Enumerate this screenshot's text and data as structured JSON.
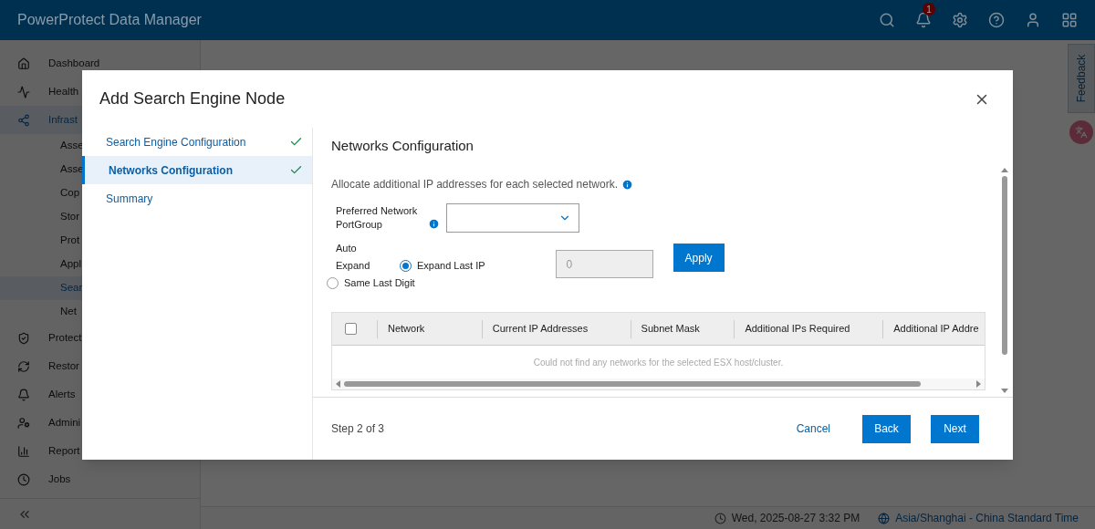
{
  "app": {
    "title": "PowerProtect Data Manager",
    "notification_count": "1"
  },
  "sidebar": {
    "items": [
      {
        "label": "Dashboard",
        "selected": false
      },
      {
        "label": "Health",
        "selected": false
      },
      {
        "label": "Infrast",
        "selected": true,
        "children": [
          {
            "label": "Asse",
            "selected": false
          },
          {
            "label": "Asse",
            "selected": false
          },
          {
            "label": "Cop",
            "selected": false
          },
          {
            "label": "Stor",
            "selected": false
          },
          {
            "label": "Prot",
            "selected": false
          },
          {
            "label": "Appl",
            "selected": false
          },
          {
            "label": "Sear",
            "selected": true
          },
          {
            "label": "Net",
            "selected": false
          }
        ]
      },
      {
        "label": "Protect",
        "selected": false
      },
      {
        "label": "Restor",
        "selected": false
      },
      {
        "label": "Alerts",
        "selected": false
      },
      {
        "label": "Admini",
        "selected": false
      },
      {
        "label": "Report",
        "selected": false
      },
      {
        "label": "Jobs",
        "selected": false
      }
    ]
  },
  "feedback_tab": {
    "label": "Feedback"
  },
  "status_bar": {
    "datetime": "Wed, 2025-08-27 3:32 PM",
    "timezone": "Asia/Shanghai - China Standard Time"
  },
  "dialog": {
    "title": "Add Search Engine Node",
    "steps": [
      {
        "label": "Search Engine Configuration",
        "done": true,
        "selected": false
      },
      {
        "label": "Networks Configuration",
        "done": true,
        "selected": true
      },
      {
        "label": "Summary",
        "done": false,
        "selected": false
      }
    ],
    "heading": "Networks Configuration",
    "description": "Allocate additional IP addresses for each selected network.",
    "portgroup": {
      "label": "Preferred Network PortGroup"
    },
    "auto_expand": {
      "label_1": "Auto",
      "label_2": "Expand",
      "options": [
        {
          "label": "Expand Last IP",
          "selected": true
        },
        {
          "label": "Same Last Digit",
          "selected": false
        }
      ],
      "value": "0",
      "disabled": true
    },
    "apply": "Apply",
    "table": {
      "select_all": false,
      "columns": [
        "Network",
        "Current IP Addresses",
        "Subnet Mask",
        "Additional IPs Required",
        "Additional IP Addre"
      ],
      "empty_message": "Could not find any networks for the selected ESX host/cluster."
    },
    "step_text": "Step 2 of 3",
    "buttons": {
      "cancel": "Cancel",
      "back": "Back",
      "next": "Next"
    }
  }
}
